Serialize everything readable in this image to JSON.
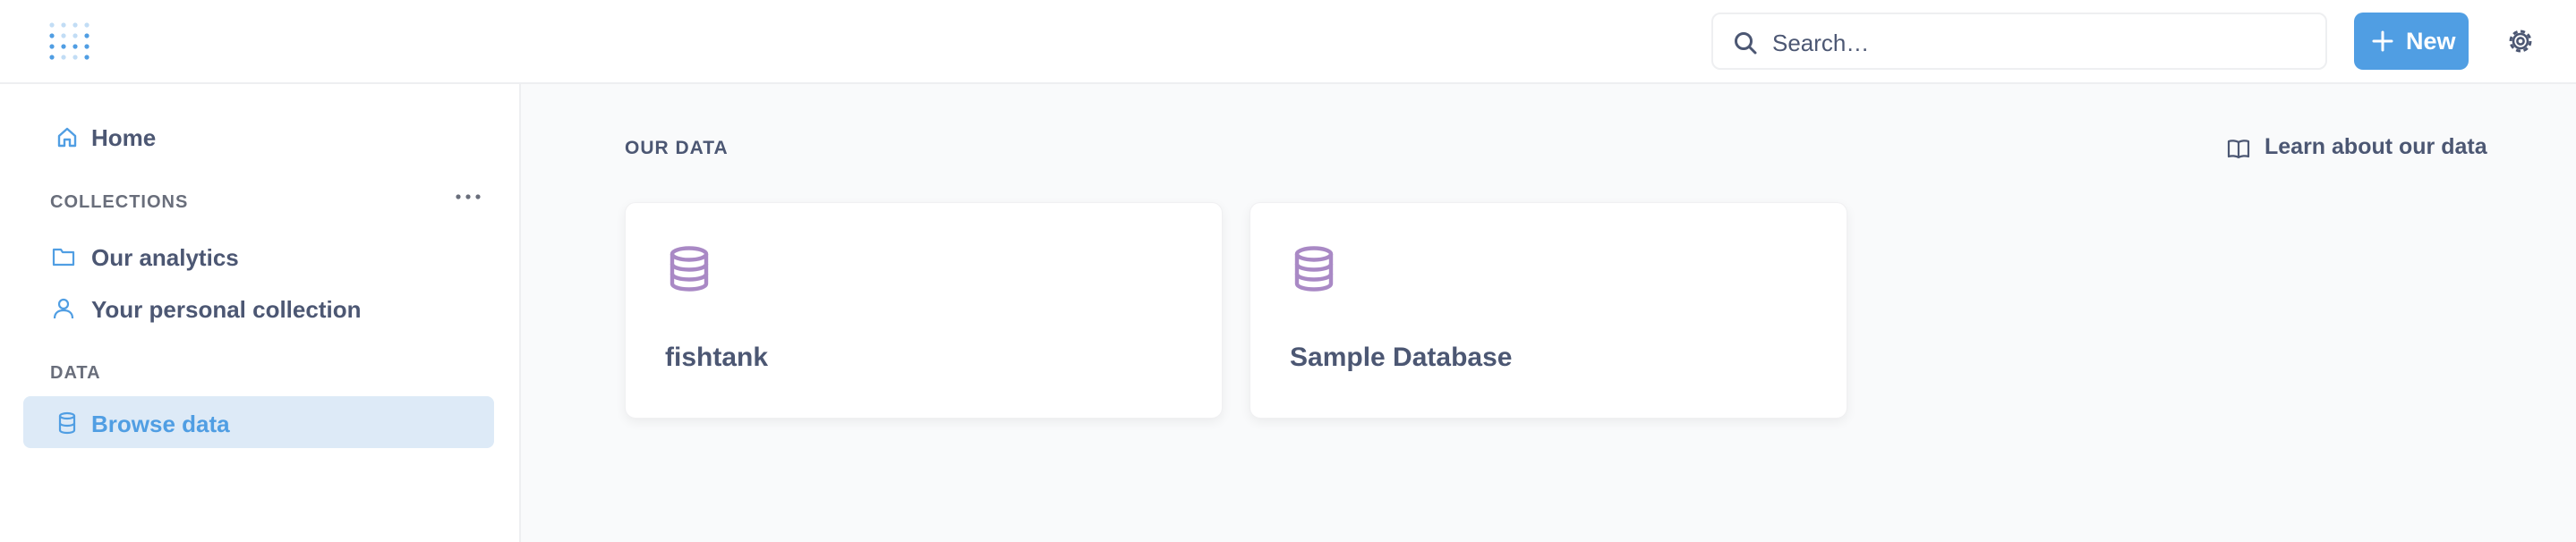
{
  "colors": {
    "brand": "#509ee3",
    "text": "#4c5773",
    "muted": "#696e7b",
    "active_bg": "#ddeaf7",
    "db_icon": "#a989c5",
    "page_bg": "#f9fafb"
  },
  "header": {
    "logo_icon": "metabase-logo-icon",
    "search": {
      "placeholder": "Search…",
      "icon": "search-icon"
    },
    "new_button": {
      "label": "New",
      "icon": "plus-icon"
    },
    "settings_icon": "gear-icon"
  },
  "sidebar": {
    "home": {
      "label": "Home",
      "icon": "home-icon"
    },
    "collections_label": "COLLECTIONS",
    "collections_menu_icon": "ellipsis-icon",
    "collections": [
      {
        "label": "Our analytics",
        "icon": "folder-icon"
      },
      {
        "label": "Your personal collection",
        "icon": "person-icon"
      }
    ],
    "data_label": "DATA",
    "browse_data": {
      "label": "Browse data",
      "icon": "database-icon",
      "active": true
    }
  },
  "main": {
    "section_title": "OUR DATA",
    "learn_link": {
      "label": "Learn about our data",
      "icon": "book-icon"
    },
    "databases": [
      {
        "name": "fishtank",
        "icon": "database-icon"
      },
      {
        "name": "Sample Database",
        "icon": "database-icon"
      }
    ]
  }
}
